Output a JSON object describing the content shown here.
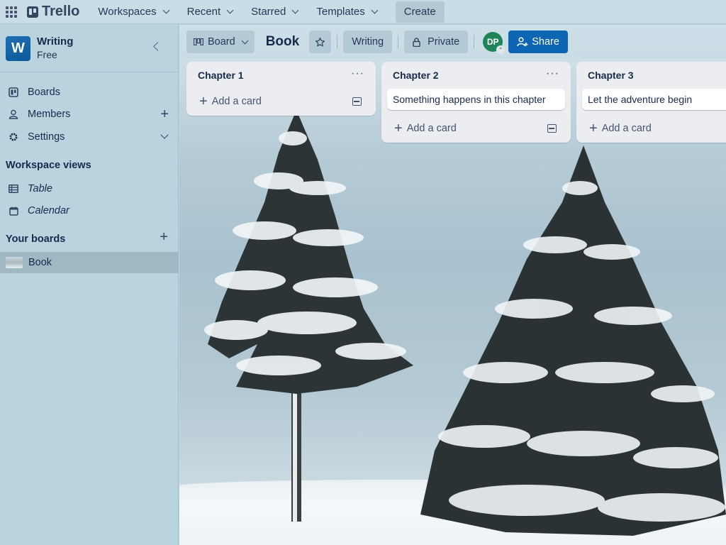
{
  "topnav": {
    "logo": "Trello",
    "items": [
      {
        "label": "Workspaces"
      },
      {
        "label": "Recent"
      },
      {
        "label": "Starred"
      },
      {
        "label": "Templates"
      }
    ],
    "create_label": "Create"
  },
  "sidebar": {
    "workspace": {
      "initial": "W",
      "name": "Writing",
      "plan": "Free"
    },
    "items": [
      {
        "label": "Boards",
        "icon": "board-icon"
      },
      {
        "label": "Members",
        "icon": "person-icon",
        "action": "+"
      },
      {
        "label": "Settings",
        "icon": "gear-icon"
      }
    ],
    "views_title": "Workspace views",
    "views": [
      {
        "label": "Table",
        "icon": "table-icon"
      },
      {
        "label": "Calendar",
        "icon": "calendar-icon"
      }
    ],
    "boards_title": "Your boards",
    "boards_action": "+",
    "boards": [
      {
        "label": "Book",
        "active": true
      }
    ]
  },
  "board_header": {
    "view_label": "Board",
    "title": "Book",
    "workspace_label": "Writing",
    "visibility_label": "Private",
    "member_initials": "DP",
    "share_label": "Share"
  },
  "lists": [
    {
      "title": "Chapter 1",
      "cards": [],
      "add_label": "Add a card"
    },
    {
      "title": "Chapter 2",
      "cards": [
        {
          "title": "Something happens in this chapter"
        }
      ],
      "add_label": "Add a card"
    },
    {
      "title": "Chapter 3",
      "cards": [
        {
          "title": "Let the adventure begin"
        }
      ],
      "add_label": "Add a card"
    }
  ],
  "colors": {
    "share_button": "#0c66b4",
    "workspace_avatar": "#1f6fb4",
    "member_avatar": "#1f845a",
    "sidebar_bg": "#b9d3df",
    "list_bg": "#ebedf0"
  }
}
